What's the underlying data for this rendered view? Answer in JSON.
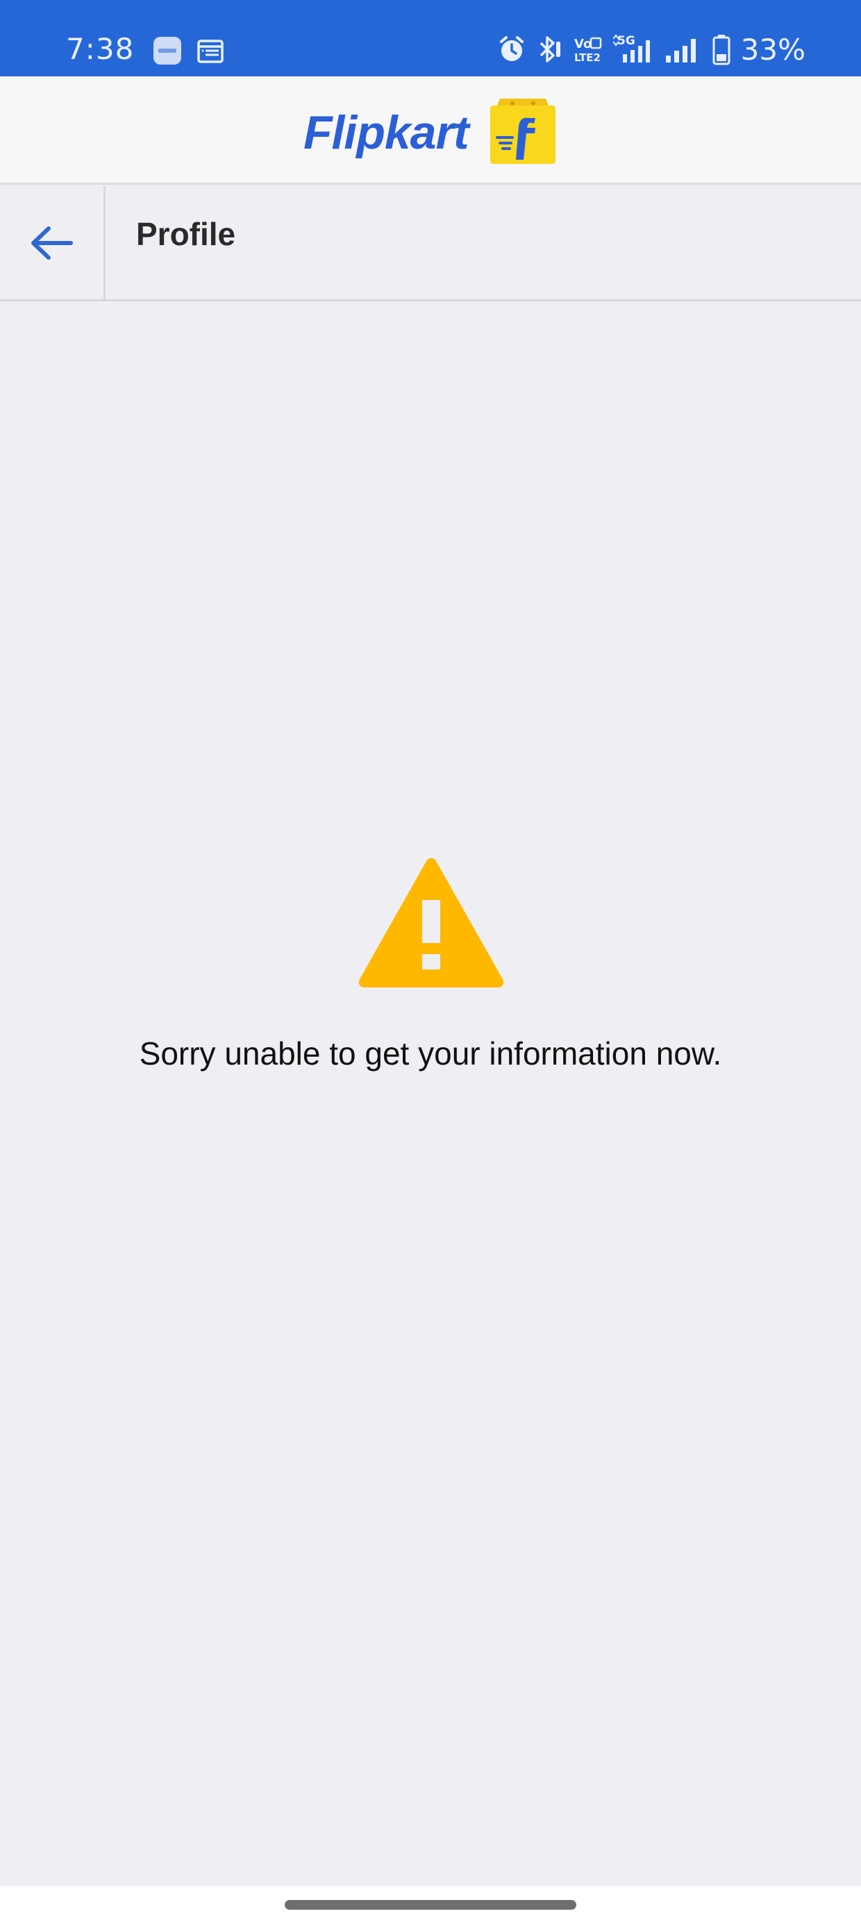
{
  "status_bar": {
    "time": "7:38",
    "battery": "33%",
    "icons": [
      "zomato-app-icon",
      "calendar-app-icon",
      "alarm-icon",
      "bluetooth-icon",
      "volte-icon",
      "5g-signal-icon",
      "signal-icon",
      "battery-icon"
    ]
  },
  "brand": {
    "name": "Flipkart"
  },
  "header": {
    "back_icon": "arrow-left-icon",
    "title": "Profile"
  },
  "error": {
    "icon": "warning-icon",
    "message": "Sorry unable to get your information now."
  },
  "colors": {
    "status_bar": "#2667d8",
    "brand_blue": "#2b5fd6",
    "logo_yellow": "#f9d71c",
    "warning_amber": "#ffb800",
    "background": "#efeff3"
  }
}
